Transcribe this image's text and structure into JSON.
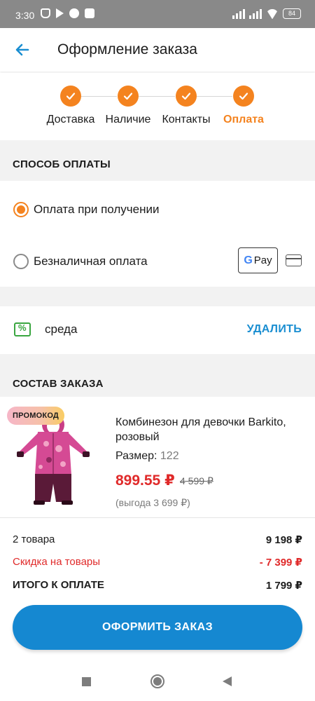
{
  "status_bar": {
    "time": "3:30",
    "battery": "84",
    "icons": [
      "mute-icon",
      "play-icon",
      "circle-icon",
      "square-icon",
      "signal-icon",
      "signal-icon",
      "wifi-icon",
      "battery-icon"
    ]
  },
  "header": {
    "title": "Оформление заказа",
    "back_icon": "arrow-left-icon"
  },
  "stepper": {
    "steps": [
      {
        "label": "Доставка",
        "done": true
      },
      {
        "label": "Наличие",
        "done": true
      },
      {
        "label": "Контакты",
        "done": true
      },
      {
        "label": "Оплата",
        "done": true,
        "active": true
      }
    ]
  },
  "payment": {
    "section_title": "СПОСОБ ОПЛАТЫ",
    "options": [
      {
        "label": "Оплата при получении",
        "selected": true
      },
      {
        "label": "Безналичная оплата",
        "selected": false
      }
    ],
    "gpay_label": "Pay",
    "gpay_g": "G"
  },
  "promo": {
    "code": "среда",
    "remove_label": "УДАЛИТЬ"
  },
  "order": {
    "section_title": "СОСТАВ ЗАКАЗА",
    "item": {
      "badge": "ПРОМОКОД",
      "name": "Комбинезон для девочки Barkito, розовый",
      "size_label": "Размер:",
      "size_value": "122",
      "price": "899.55 ₽",
      "old_price": "4 599 ₽",
      "saving": "(выгода 3 699 ₽)"
    }
  },
  "summary": {
    "items_label": "2 товара",
    "items_value": "9 198 ₽",
    "discount_label": "Скидка на товары",
    "discount_value": "- 7 399 ₽",
    "total_label": "ИТОГО К ОПЛАТЕ",
    "total_value": "1 799 ₽"
  },
  "checkout_button": "ОФОРМИТЬ ЗАКАЗ",
  "colors": {
    "accent_orange": "#f4831f",
    "primary_blue": "#1588d1",
    "discount_red": "#e02a2a",
    "promo_green": "#3aa640"
  }
}
